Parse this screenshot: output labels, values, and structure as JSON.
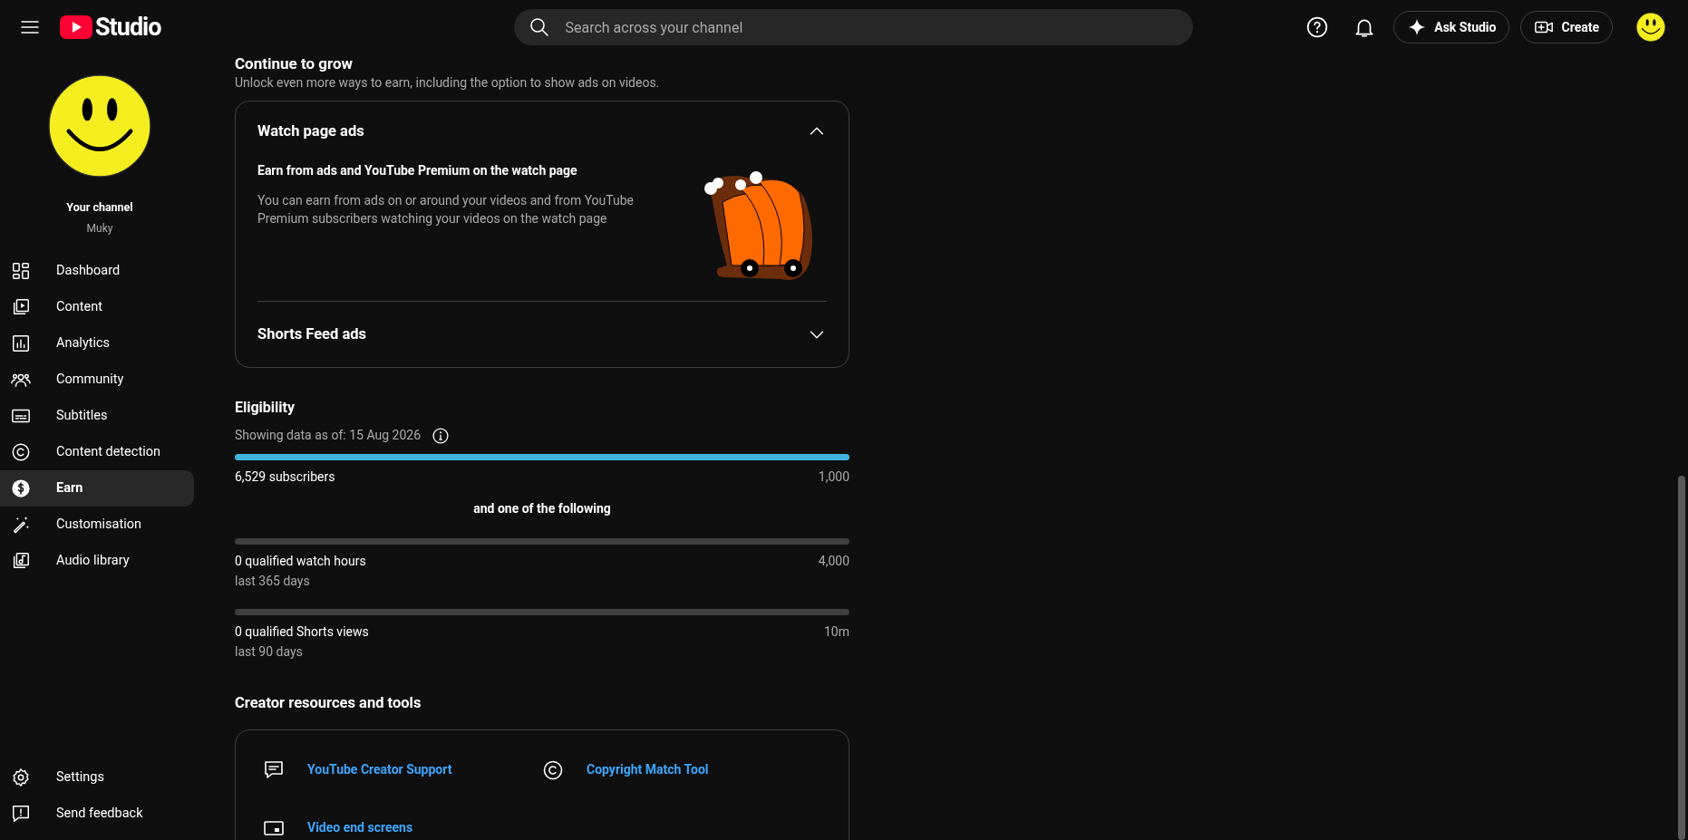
{
  "header": {
    "logo_text": "Studio",
    "search": {
      "placeholder": "Search across your channel"
    },
    "buttons": [
      {
        "kind": "ask",
        "label": "Ask Studio"
      },
      {
        "kind": "create",
        "label": "Create"
      }
    ]
  },
  "sidebar": {
    "channel": {
      "title": "Your channel",
      "name": "Muky"
    },
    "items": [
      {
        "label": "Dashboard",
        "selected": false
      },
      {
        "label": "Content",
        "selected": false
      },
      {
        "label": "Analytics",
        "selected": false
      },
      {
        "label": "Community",
        "selected": false
      },
      {
        "label": "Subtitles",
        "selected": false
      },
      {
        "label": "Content detection",
        "selected": false
      },
      {
        "label": "Earn",
        "selected": true
      },
      {
        "label": "Customisation",
        "selected": false
      },
      {
        "label": "Audio library",
        "selected": false
      }
    ],
    "footer_items": [
      {
        "label": "Settings"
      },
      {
        "label": "Send feedback"
      }
    ]
  },
  "grow": {
    "title": "Continue to grow",
    "subtitle": "Unlock even more ways to earn, including the option to show ads on videos.",
    "sections": [
      {
        "title": "Watch page ads",
        "expanded": true,
        "heading": "Earn from ads and YouTube Premium on the watch page",
        "body": "You can earn from ads on or around your videos and from YouTube Premium subscribers watching your videos on the watch page"
      },
      {
        "title": "Shorts Feed ads",
        "expanded": false
      }
    ]
  },
  "eligibility": {
    "title": "Eligibility",
    "as_of": "Showing data as of: 15 Aug 2026",
    "requirements": [
      {
        "label": "6,529 subscribers",
        "target": "1,000",
        "level": 1
      },
      {
        "label": "0 qualified watch hours",
        "period": "last 365 days",
        "target": "4,000",
        "level": 0
      },
      {
        "label": "0 qualified Shorts views",
        "period": "last 90 days",
        "target": "10m",
        "level": 0
      }
    ],
    "separator": "and one of the following"
  },
  "resources": {
    "title": "Creator resources and tools",
    "links": [
      {
        "label": "YouTube Creator Support"
      },
      {
        "label": "Copyright Match Tool"
      },
      {
        "label": "Video end screens"
      }
    ]
  }
}
